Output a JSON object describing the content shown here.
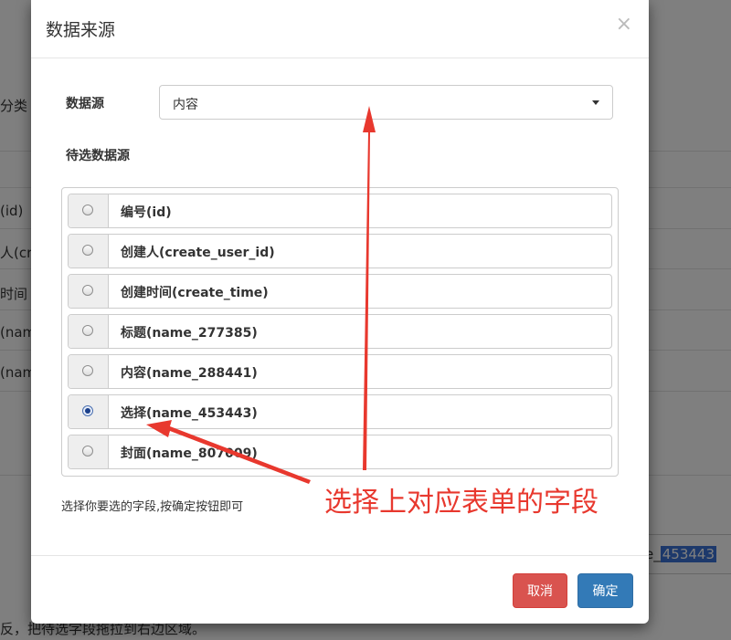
{
  "background": {
    "fragments": [
      "分类",
      "(id)",
      "人(cre",
      "时间",
      "(nam",
      "(nam"
    ],
    "input_value_prefix": "e_",
    "input_value_selected": "453443",
    "bottom_text": "反，把待选字段拖拉到右边区域。"
  },
  "modal": {
    "title": "数据来源",
    "close_symbol": "×",
    "datasource_label": "数据源",
    "datasource_value": "内容",
    "pending_label": "待选数据源",
    "fields": [
      {
        "label": "编号(id)",
        "checked": false
      },
      {
        "label": "创建人(create_user_id)",
        "checked": false
      },
      {
        "label": "创建时间(create_time)",
        "checked": false
      },
      {
        "label": "标题(name_277385)",
        "checked": false
      },
      {
        "label": "内容(name_288441)",
        "checked": false
      },
      {
        "label": "选择(name_453443)",
        "checked": true
      },
      {
        "label": "封面(name_807009)",
        "checked": false
      }
    ],
    "hint": "选择你要选的字段,按确定按钮即可",
    "cancel_label": "取消",
    "ok_label": "确定"
  },
  "annotation": {
    "text": "选择上对应表单的字段",
    "color": "#e8382e"
  },
  "colors": {
    "cancel": "#d9534f",
    "ok": "#337ab7"
  }
}
